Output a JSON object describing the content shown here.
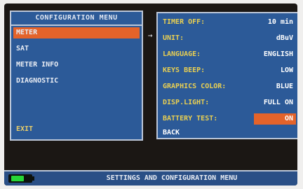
{
  "config_menu": {
    "title": "CONFIGURATION MENU",
    "items": [
      {
        "label": "METER",
        "selected": true
      },
      {
        "label": "SAT",
        "selected": false
      },
      {
        "label": "METER INFO",
        "selected": false
      },
      {
        "label": "DIAGNOSTIC",
        "selected": false
      }
    ],
    "exit_label": "EXIT"
  },
  "arrow": "→",
  "meter_settings": {
    "rows": [
      {
        "label": "TIMER OFF:",
        "value": "10 min"
      },
      {
        "label": "UNIT:",
        "value": "dBuV"
      },
      {
        "label": "LANGUAGE:",
        "value": "ENGLISH"
      },
      {
        "label": "KEYS BEEP:",
        "value": "LOW"
      },
      {
        "label": "GRAPHICS COLOR:",
        "value": "BLUE"
      },
      {
        "label": "DISP.LIGHT:",
        "value": "FULL ON"
      },
      {
        "label": "BATTERY TEST:",
        "value": "ON",
        "highlighted": true
      }
    ],
    "back_label": "BACK"
  },
  "status_bar": {
    "text": "SETTINGS AND CONFIGURATION MENU",
    "battery_level": 0.7,
    "battery_icon": "battery-icon"
  },
  "colors": {
    "panel_bg": "#2c5a98",
    "selection": "#e4632a",
    "label_yellow": "#e9cf52",
    "battery_green": "#27d638"
  }
}
